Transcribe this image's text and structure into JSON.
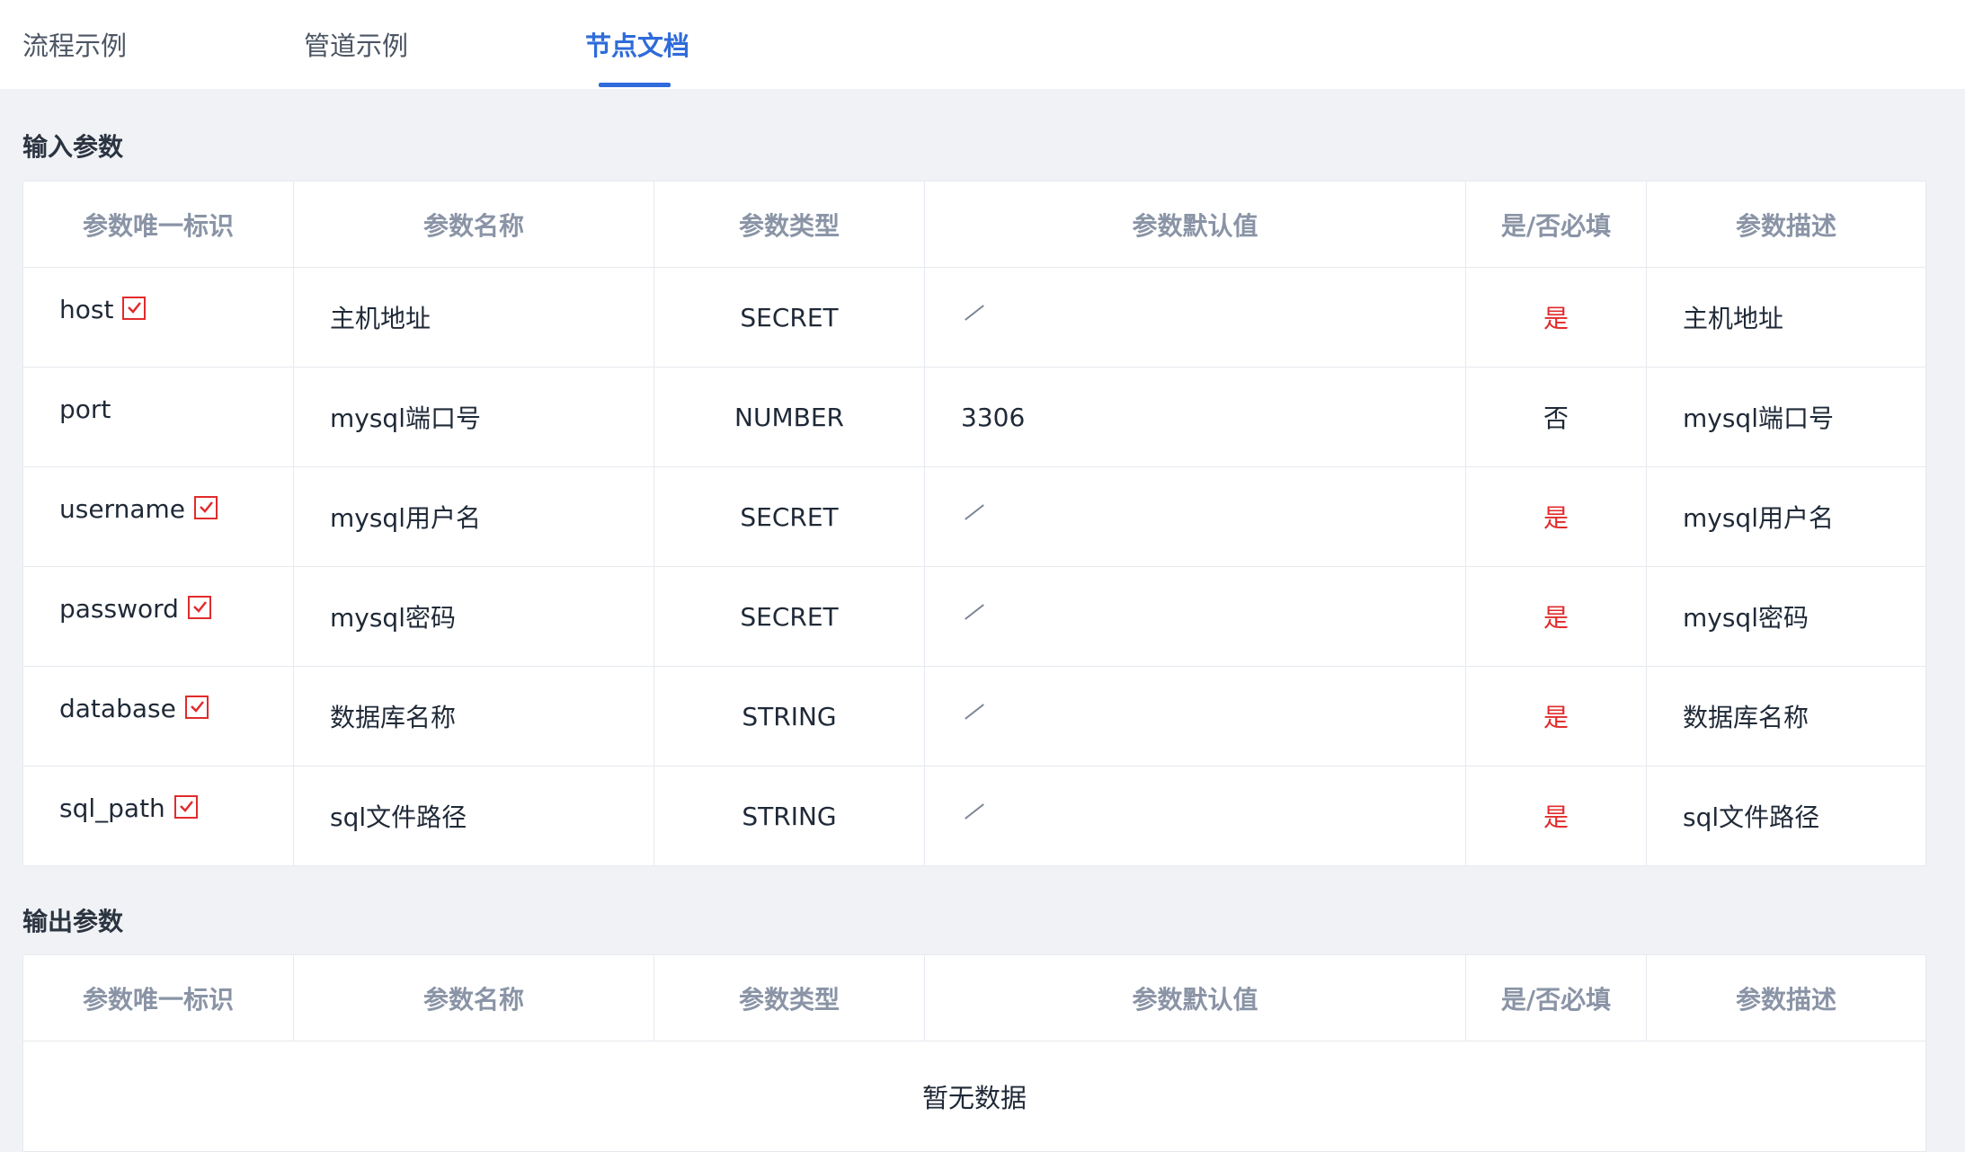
{
  "tabs": [
    {
      "label": "流程示例"
    },
    {
      "label": "管道示例"
    },
    {
      "label": "节点文档"
    }
  ],
  "active_tab": "节点文档",
  "input_section": {
    "title": "输入参数",
    "headers": [
      "参数唯一标识",
      "参数名称",
      "参数类型",
      "参数默认值",
      "是/否必填",
      "参数描述"
    ],
    "rows": [
      {
        "id": "host",
        "required_mark": true,
        "name": "主机地址",
        "type": "SECRET",
        "default": "",
        "required": "是",
        "desc": "主机地址"
      },
      {
        "id": "port",
        "required_mark": false,
        "name": "mysql端口号",
        "type": "NUMBER",
        "default": "3306",
        "required": "否",
        "desc": "mysql端口号"
      },
      {
        "id": "username",
        "required_mark": true,
        "name": "mysql用户名",
        "type": "SECRET",
        "default": "",
        "required": "是",
        "desc": "mysql用户名"
      },
      {
        "id": "password",
        "required_mark": true,
        "name": "mysql密码",
        "type": "SECRET",
        "default": "",
        "required": "是",
        "desc": "mysql密码"
      },
      {
        "id": "database",
        "required_mark": true,
        "name": "数据库名称",
        "type": "STRING",
        "default": "",
        "required": "是",
        "desc": "数据库名称"
      },
      {
        "id": "sql_path",
        "required_mark": true,
        "name": "sql文件路径",
        "type": "STRING",
        "default": "",
        "required": "是",
        "desc": "sql文件路径"
      }
    ]
  },
  "output_section": {
    "title": "输出参数",
    "headers": [
      "参数唯一标识",
      "参数名称",
      "参数类型",
      "参数默认值",
      "是/否必填",
      "参数描述"
    ],
    "empty_text": "暂无数据"
  },
  "colors": {
    "accent": "#2f6bda",
    "required": "#e12b2b",
    "background": "#f0f2f5"
  },
  "icons": {
    "required_mark": "checkbox-check-icon",
    "empty_default": "slash-icon"
  }
}
